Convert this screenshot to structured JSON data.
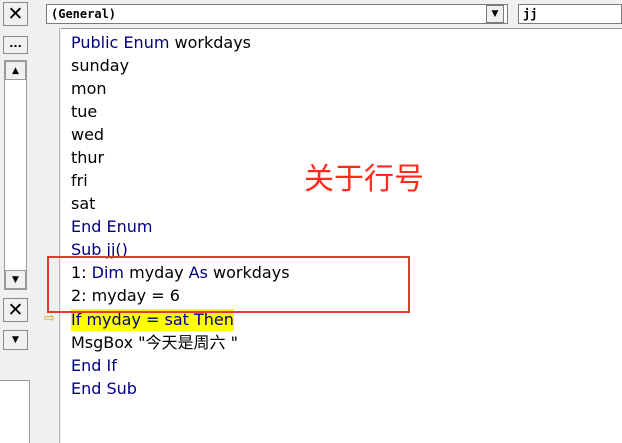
{
  "object_combo": {
    "value": "(General)"
  },
  "procedure_combo": {
    "value": "jj"
  },
  "left_panel": {
    "close_glyph": "✕",
    "ellipsis": "...",
    "close_glyph_2": "✕"
  },
  "code": {
    "enum_header_kw": "Public Enum",
    "enum_name": " workdays",
    "members": [
      "sunday",
      "mon",
      "tue",
      "wed",
      "thur",
      "fri",
      "sat"
    ],
    "end_enum": "End Enum",
    "sub_decl": "Sub jj()",
    "line1_num": "1: ",
    "line1_dim": "Dim",
    "line1_var": " myday ",
    "line1_as": "As",
    "line1_type": " workdays",
    "line2": "2: myday = 6",
    "if_line": "If myday = sat Then",
    "msgbox": "MsgBox \"今天是周六 \"",
    "end_if": "End If",
    "end_sub": "End Sub"
  },
  "annotation": {
    "text": "关于行号"
  },
  "colors": {
    "keyword": "#00007f",
    "highlight": "#ffff00",
    "annotation": "#ff2a1a",
    "exec_arrow": "#c8a400"
  },
  "icons": {
    "exec_arrow": "execution-pointer-icon",
    "dropdown": "chevron-down-icon",
    "scroll_up": "scroll-up-icon",
    "scroll_down": "scroll-down-icon"
  }
}
